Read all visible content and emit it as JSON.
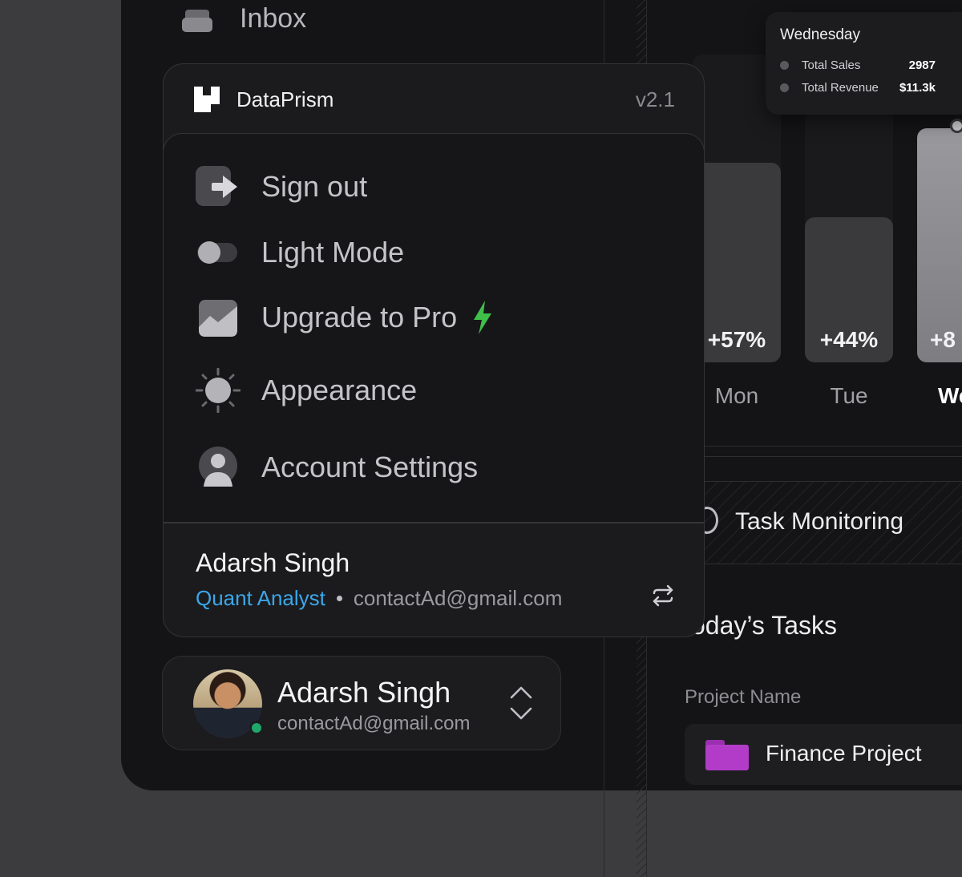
{
  "sidebar": {
    "inbox_label": "Inbox"
  },
  "chart": {
    "bars": [
      {
        "pct": "+57%",
        "day": "Mon"
      },
      {
        "pct": "+44%",
        "day": "Tue"
      },
      {
        "pct": "+8",
        "day": "We"
      }
    ],
    "tooltip": {
      "title": "Wednesday",
      "rows": [
        {
          "label": "Total Sales",
          "value": "2987"
        },
        {
          "label": "Total Revenue",
          "value": "$11.3k"
        }
      ]
    }
  },
  "tasks": {
    "section_title": "Task Monitoring",
    "todays_title": "oday’s Tasks",
    "column_header": "Project Name",
    "project_name": "Finance Project"
  },
  "popover": {
    "brand": "DataPrism",
    "version": "v2.1",
    "menu": [
      {
        "label": "Sign out",
        "icon": "sign-out-icon"
      },
      {
        "label": "Light Mode",
        "icon": "toggle-icon"
      },
      {
        "label": "Upgrade to Pro",
        "icon": "chart-icon"
      },
      {
        "label": "Appearance",
        "icon": "sun-icon"
      },
      {
        "label": "Account Settings",
        "icon": "user-icon"
      }
    ],
    "user": {
      "name": "Adarsh Singh",
      "role": "Quant Analyst",
      "email": "contactAd@gmail.com"
    }
  },
  "user_card": {
    "name": "Adarsh Singh",
    "email": "contactAd@gmail.com"
  },
  "colors": {
    "accent_blue": "#3aa7e8",
    "bolt_green": "#3fbf4a",
    "online_green": "#1fa86b",
    "folder_purple": "#b23cc8"
  }
}
